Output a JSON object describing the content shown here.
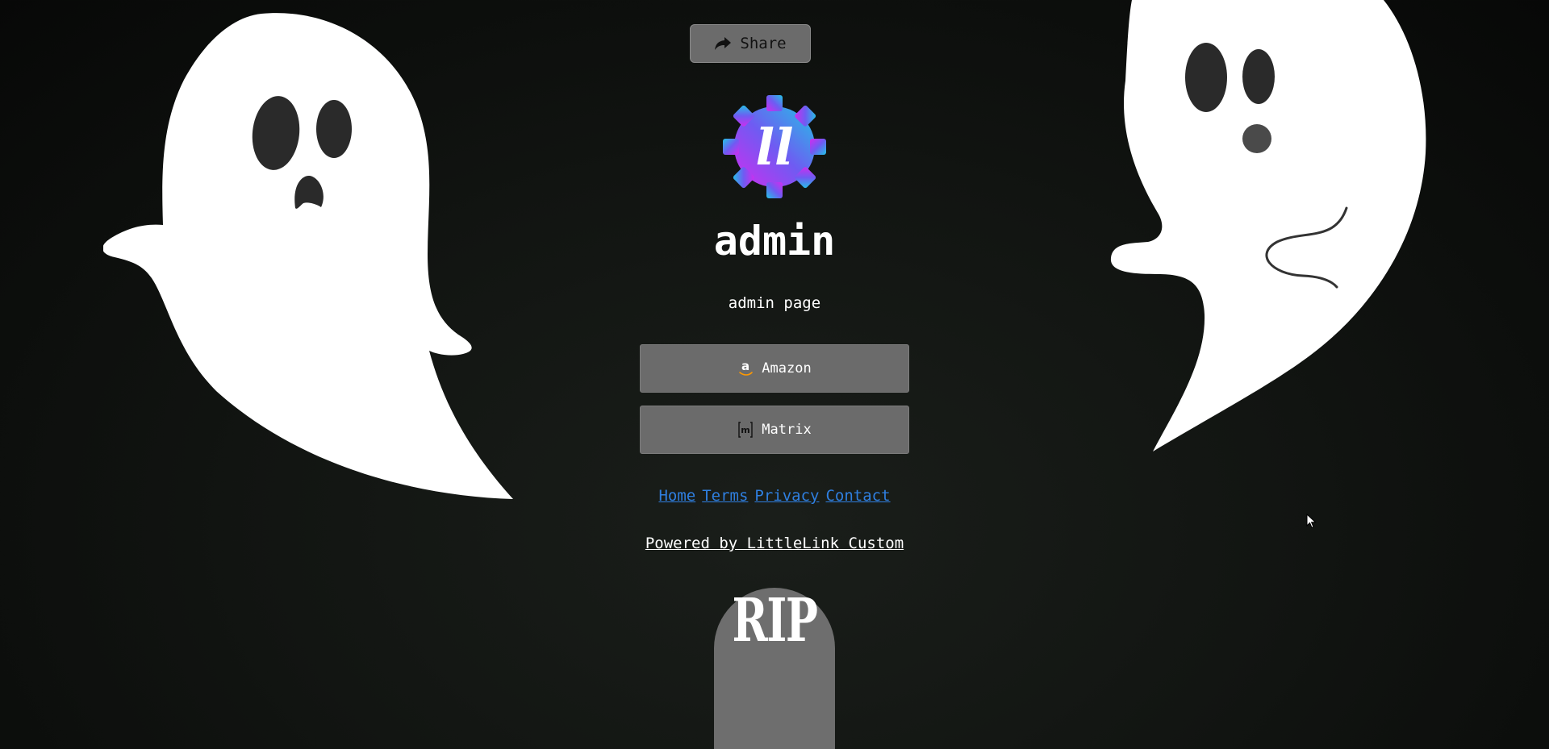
{
  "header": {
    "share_label": "Share",
    "share_icon": "share-arrow-icon"
  },
  "profile": {
    "logo_icon": "littlelink-gear-logo",
    "logo_text": "ll",
    "name": "admin",
    "description": "admin page"
  },
  "links": [
    {
      "label": "Amazon",
      "icon": "amazon-icon",
      "icon_glyph": "a"
    },
    {
      "label": "Matrix",
      "icon": "matrix-icon",
      "icon_glyph": "m"
    }
  ],
  "footer": {
    "links": [
      "Home",
      "Terms",
      "Privacy",
      "Contact"
    ],
    "powered_by": "Powered by LittleLink Custom"
  },
  "decor": {
    "tombstone_text": "RIP"
  },
  "colors": {
    "background": "#121512",
    "button": "#6b6b6b",
    "link": "#2f7fe0",
    "text": "#ffffff",
    "ghost": "#ffffff",
    "ghost_features": "#2a2a2a",
    "logo_gradient": [
      "#d12cf0",
      "#6f5bf2",
      "#22c3e6"
    ]
  }
}
